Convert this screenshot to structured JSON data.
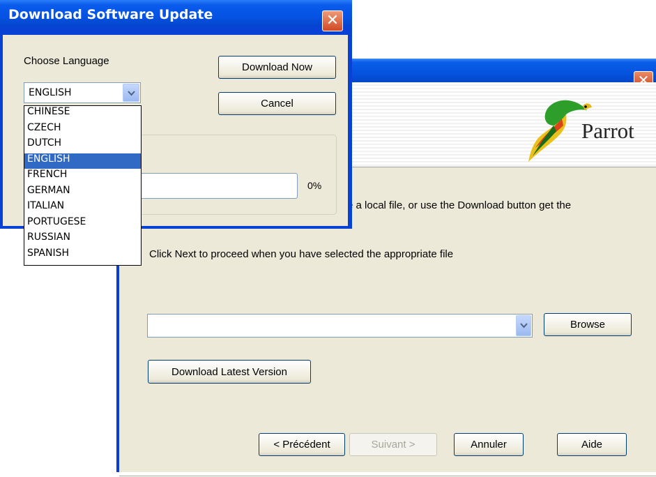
{
  "wizard": {
    "brand": "Parrot",
    "close_glyph": "✕",
    "instruction_partial": "e a local file, or use the Download button get the",
    "proceed_text": "Click Next to proceed when you have selected the appropriate file",
    "file_combo_value": "",
    "browse_label": "Browse",
    "download_latest_label": "Download Latest Version",
    "footer": {
      "previous_label": "< Précédent",
      "next_label": "Suivant >",
      "cancel_label": "Annuler",
      "help_label": "Aide"
    }
  },
  "dialog": {
    "title": "Download Software Update",
    "close_glyph": "✕",
    "choose_language_label": "Choose Language",
    "selected_language": "ENGLISH",
    "download_now_label": "Download Now",
    "cancel_label": "Cancel",
    "progress": {
      "percent_text": "0%",
      "value": 0
    },
    "languages": [
      "CHINESE",
      "CZECH",
      "DUTCH",
      "ENGLISH",
      "FRENCH",
      "GERMAN",
      "ITALIAN",
      "PORTUGESE",
      "RUSSIAN",
      "SPANISH"
    ],
    "highlighted_language": "ENGLISH"
  },
  "colors": {
    "titlebar_blue": "#0552e3",
    "window_face": "#ece9d8",
    "selection_blue": "#316ac5",
    "close_red": "#cf4a23"
  },
  "icons": [
    "close-icon",
    "dropdown-arrow-icon",
    "parrot-logo"
  ]
}
